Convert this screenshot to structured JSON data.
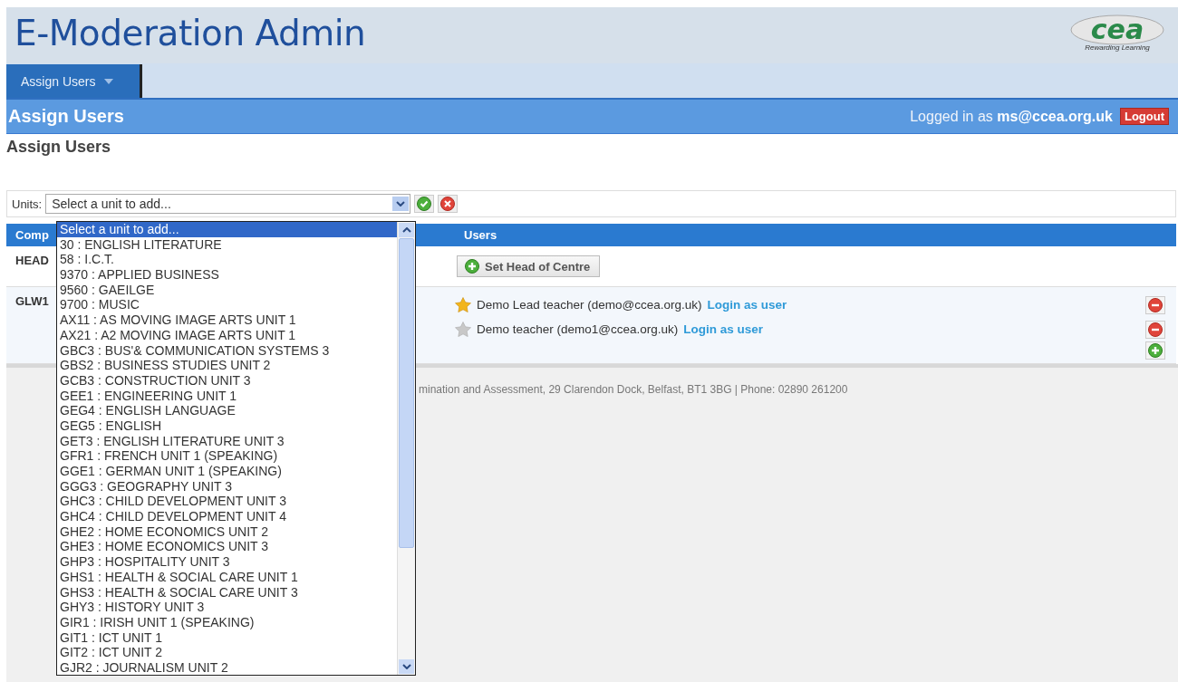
{
  "header": {
    "title": "E-Moderation Admin",
    "logo": {
      "mark": "cea",
      "tagline": "Rewarding Learning"
    }
  },
  "nav": {
    "tabs": [
      {
        "label": "Assign Users",
        "selected": true
      }
    ]
  },
  "title_bar": {
    "title": "Assign Users",
    "login_prefix": "Logged in as",
    "login_user": "ms@ccea.org.uk",
    "logout": "Logout"
  },
  "page_heading": "Assign Users",
  "units": {
    "label": "Units:",
    "value": "Select a unit to add...",
    "options": [
      {
        "label": "Select a unit to add...",
        "selected": true
      },
      {
        "label": "30 : ENGLISH LITERATURE",
        "selected": false
      },
      {
        "label": "58 : I.C.T.",
        "selected": false
      },
      {
        "label": "9370 : APPLIED BUSINESS",
        "selected": false
      },
      {
        "label": "9560 : GAEILGE",
        "selected": false
      },
      {
        "label": "9700 : MUSIC",
        "selected": false
      },
      {
        "label": "AX11 : AS MOVING IMAGE ARTS UNIT 1",
        "selected": false
      },
      {
        "label": "AX21 : A2 MOVING IMAGE ARTS UNIT 1",
        "selected": false
      },
      {
        "label": "GBC3 : BUS'& COMMUNICATION SYSTEMS 3",
        "selected": false
      },
      {
        "label": "GBS2 : BUSINESS STUDIES UNIT 2",
        "selected": false
      },
      {
        "label": "GCB3 : CONSTRUCTION UNIT 3",
        "selected": false
      },
      {
        "label": "GEE1 : ENGINEERING UNIT 1",
        "selected": false
      },
      {
        "label": "GEG4 : ENGLISH LANGUAGE",
        "selected": false
      },
      {
        "label": "GEG5 : ENGLISH",
        "selected": false
      },
      {
        "label": "GET3 : ENGLISH LITERATURE UNIT 3",
        "selected": false
      },
      {
        "label": "GFR1 : FRENCH UNIT 1 (SPEAKING)",
        "selected": false
      },
      {
        "label": "GGE1 : GERMAN UNIT 1 (SPEAKING)",
        "selected": false
      },
      {
        "label": "GGG3 : GEOGRAPHY UNIT 3",
        "selected": false
      },
      {
        "label": "GHC3 : CHILD DEVELOPMENT UNIT 3",
        "selected": false
      },
      {
        "label": "GHC4 : CHILD DEVELOPMENT UNIT 4",
        "selected": false
      },
      {
        "label": "GHE2 : HOME ECONOMICS UNIT 2",
        "selected": false
      },
      {
        "label": "GHE3 : HOME ECONOMICS UNIT 3",
        "selected": false
      },
      {
        "label": "GHP3 : HOSPITALITY UNIT 3",
        "selected": false
      },
      {
        "label": "GHS1 : HEALTH & SOCIAL CARE UNIT 1",
        "selected": false
      },
      {
        "label": "GHS3 : HEALTH & SOCIAL CARE UNIT 3",
        "selected": false
      },
      {
        "label": "GHY3 : HISTORY UNIT 3",
        "selected": false
      },
      {
        "label": "GIR1 : IRISH UNIT 1 (SPEAKING)",
        "selected": false
      },
      {
        "label": "GIT1 : ICT UNIT 1",
        "selected": false
      },
      {
        "label": "GIT2 : ICT UNIT 2",
        "selected": false
      },
      {
        "label": "GJR2 : JOURNALISM UNIT 2",
        "selected": false
      }
    ]
  },
  "table": {
    "columns": [
      "Comp",
      "Users"
    ],
    "rows": [
      {
        "code": "HEAD",
        "action": "Set Head of Centre",
        "users": []
      },
      {
        "code": "GLW1",
        "users": [
          {
            "name": "Demo Lead teacher (demo@ccea.org.uk)",
            "link": "Login as user",
            "lead": true
          },
          {
            "name": "Demo teacher (demo1@ccea.org.uk)",
            "link": "Login as user",
            "lead": false
          }
        ]
      }
    ]
  },
  "footer": {
    "text": "mination and Assessment, 29 Clarendon Dock, Belfast, BT1 3BG | Phone: 02890 261200"
  }
}
